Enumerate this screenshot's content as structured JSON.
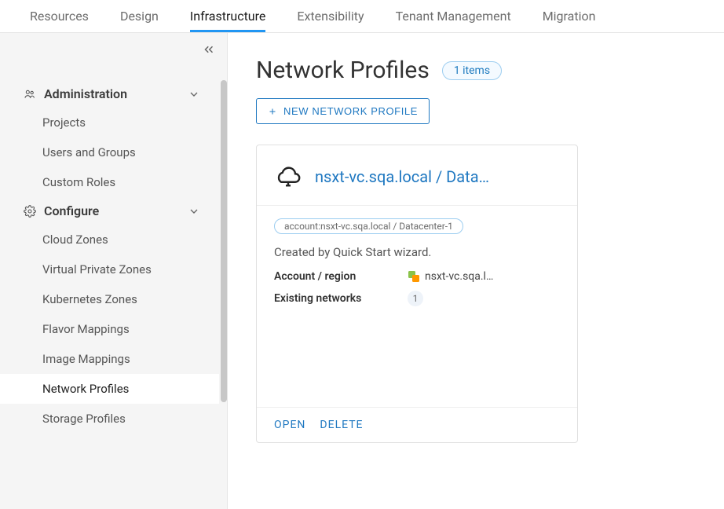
{
  "topTabs": {
    "resources": "Resources",
    "design": "Design",
    "infrastructure": "Infrastructure",
    "extensibility": "Extensibility",
    "tenantManagement": "Tenant Management",
    "migration": "Migration"
  },
  "sidebar": {
    "administration": {
      "label": "Administration",
      "items": {
        "projects": "Projects",
        "usersGroups": "Users and Groups",
        "customRoles": "Custom Roles"
      }
    },
    "configure": {
      "label": "Configure",
      "items": {
        "cloudZones": "Cloud Zones",
        "virtualPrivateZones": "Virtual Private Zones",
        "kubernetesZones": "Kubernetes Zones",
        "flavorMappings": "Flavor Mappings",
        "imageMappings": "Image Mappings",
        "networkProfiles": "Network Profiles",
        "storageProfiles": "Storage Profiles"
      }
    }
  },
  "main": {
    "title": "Network Profiles",
    "countBadge": "1 items",
    "newButtonLabel": "NEW NETWORK PROFILE"
  },
  "card": {
    "title": "nsxt-vc.sqa.local / Data…",
    "tag": "account:nsxt-vc.sqa.local / Datacenter-1",
    "description": "Created by Quick Start wizard.",
    "accountRegionKey": "Account / region",
    "accountRegionVal": "nsxt-vc.sqa.l…",
    "existingNetworksKey": "Existing networks",
    "existingNetworksCount": "1",
    "actions": {
      "open": "OPEN",
      "delete": "DELETE"
    }
  }
}
